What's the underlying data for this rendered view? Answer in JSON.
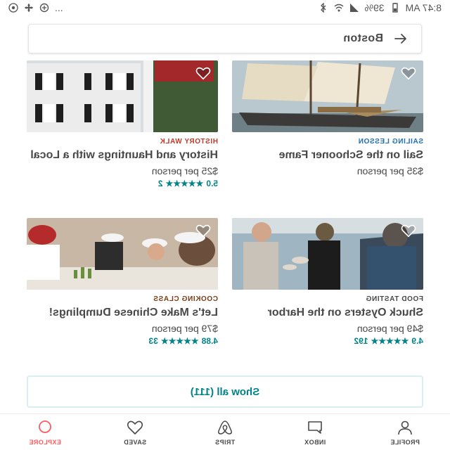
{
  "status_bar": {
    "time": "8:47 AM",
    "battery": "39%",
    "more": "..."
  },
  "search": {
    "value": "Boston"
  },
  "experiences": [
    {
      "category": "SAILING LESSON",
      "category_color": "#1f6fb2",
      "title": "Sail on the Schooner Fame",
      "price": "$35 per person",
      "rating": "",
      "reviews": ""
    },
    {
      "category": "HISTORY WALK",
      "category_color": "#c0392b",
      "title": "History and Hauntings with a Local",
      "price": "$25 per person",
      "rating": "5.0",
      "reviews": "2"
    },
    {
      "category": "FOOD TASTING",
      "category_color": "#484848",
      "title": "Shuck Oysters on the Harbor",
      "price": "$49 per person",
      "rating": "4.9",
      "reviews": "192"
    },
    {
      "category": "COOKING CLASS",
      "category_color": "#7a3b13",
      "title": "Let's Make Chinese Dumplings!",
      "price": "$79 per person",
      "rating": "4.88",
      "reviews": "33"
    }
  ],
  "show_all": "Show all (111)",
  "stars": "★★★★★",
  "nav": [
    {
      "label": "EXPLORE",
      "icon": "search-icon",
      "active": true
    },
    {
      "label": "SAVED",
      "icon": "heart-icon",
      "active": false
    },
    {
      "label": "TRIPS",
      "icon": "airbnb-logo-icon",
      "active": false
    },
    {
      "label": "INBOX",
      "icon": "chat-icon",
      "active": false
    },
    {
      "label": "PROFILE",
      "icon": "profile-icon",
      "active": false
    }
  ],
  "colors": {
    "accent": "#008489",
    "active_nav": "#FF5A5F"
  }
}
